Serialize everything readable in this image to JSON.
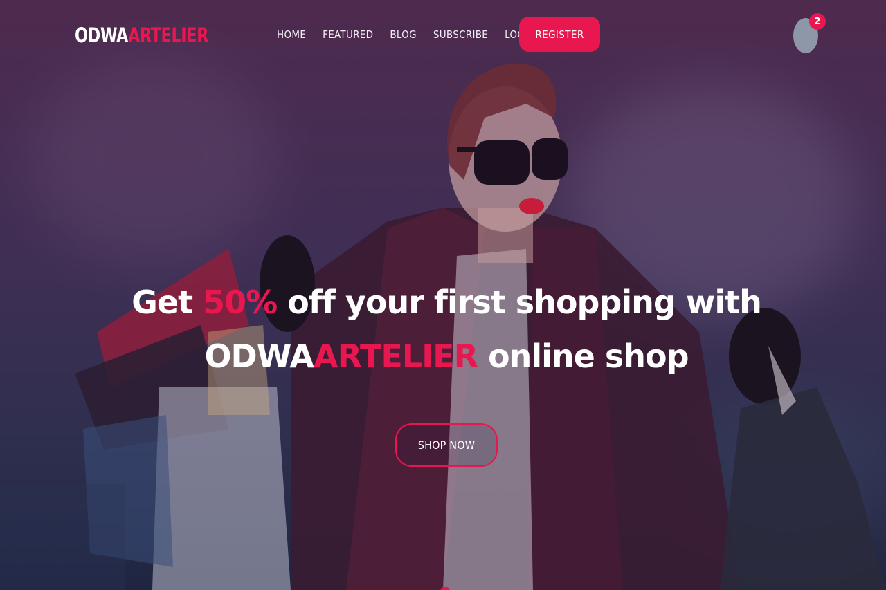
{
  "brand": {
    "logo_part1": "ODWA",
    "logo_part2": "ARTELIER",
    "accent_color": "#e8174f",
    "text_color": "#ffffff"
  },
  "nav": {
    "items": [
      {
        "label": "HOME"
      },
      {
        "label": "FEATURED"
      },
      {
        "label": "BLOG"
      },
      {
        "label": "SUBSCRIBE"
      },
      {
        "label": "LOGIN"
      }
    ],
    "register_label": "REGISTER",
    "cart_icon": "cart-icon",
    "cart_count": "2"
  },
  "hero": {
    "line1_before": "Get",
    "line1_highlight": "50%",
    "line1_after": "off your first shopping with",
    "line2_brand1": "ODWA",
    "line2_brand2": "ARTELIER",
    "line2_after": "online shop",
    "cta_label": "SHOP NOW"
  }
}
